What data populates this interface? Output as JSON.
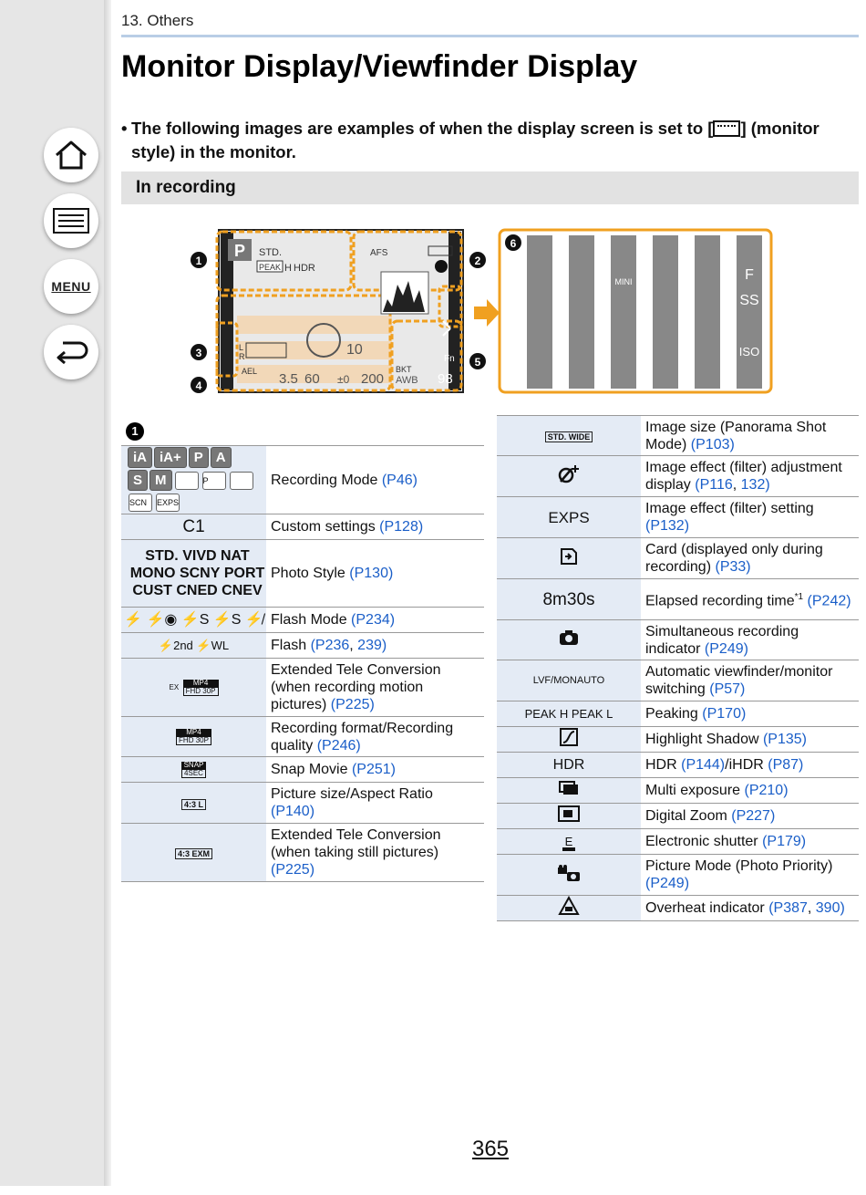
{
  "header": {
    "chapter": "13. Others",
    "title": "Monitor Display/Viewfinder Display"
  },
  "nav": {
    "menu_label": "MENU"
  },
  "intro": {
    "bullet": "•",
    "text_before": "The following images are examples of when the display screen is set to [",
    "text_after": "] (monitor style) in the monitor."
  },
  "section": {
    "title": "In recording"
  },
  "diagram": {
    "markers": [
      "1",
      "2",
      "3",
      "4",
      "5",
      "6"
    ],
    "screen": {
      "mode": "P",
      "style": "STD.",
      "peak": "PEAK",
      "peak_h": "H",
      "hdr": "HDR",
      "afs": "AFS",
      "ael": "AEL",
      "aperture": "3.5",
      "shutter": "60",
      "ev": "±0",
      "iso": "200",
      "awb": "AWB",
      "bkt": "BKT",
      "shots": "98",
      "count": "10",
      "fn": "Fn",
      "l": "L",
      "r": "R"
    },
    "tabs": [
      "MINI",
      "F",
      "SS",
      "ISO"
    ]
  },
  "left_table": {
    "heading_marker": "1",
    "mode_icons": [
      "iA",
      "iA+",
      "P",
      "A",
      "S",
      "M",
      "",
      "P",
      "",
      "SCN",
      "EXPS"
    ],
    "photo_styles": [
      "STD.",
      "VIVD",
      "NAT",
      "MONO",
      "SCNY",
      "PORT",
      "CUST",
      "CNED",
      "CNEV"
    ],
    "rows": [
      {
        "icon": "",
        "text": "Recording Mode ",
        "link": "(P46)"
      },
      {
        "icon": "C1",
        "text": "Custom settings ",
        "link": "(P128)"
      },
      {
        "icon": "",
        "text": "Photo Style ",
        "link": "(P130)"
      },
      {
        "icon": "⚡ ⚡◉ ⚡S ⚡S ⚡̸",
        "text": "Flash Mode ",
        "link": "(P234)"
      },
      {
        "icon": "⚡2nd ⚡WL",
        "text": "Flash ",
        "link": "(P236",
        "link2": "239)"
      },
      {
        "icon": "",
        "text": "Extended Tele Conversion (when recording motion pictures) ",
        "link": "(P225)"
      },
      {
        "icon": "",
        "text": "Recording format/Recording quality ",
        "link": "(P246)"
      },
      {
        "icon": "",
        "text": "Snap Movie ",
        "link": "(P251)"
      },
      {
        "icon": "4:3 L",
        "text": "Picture size/Aspect Ratio ",
        "link": "(P140)"
      },
      {
        "icon": "4:3 EXM",
        "text": "Extended Tele Conversion (when taking still pictures) ",
        "link": "(P225)"
      }
    ],
    "mp4_top": "MP4",
    "mp4_bot": "FHD 30P",
    "ex": "EX",
    "snap_top": "SNAP",
    "snap_bot": "4SEC"
  },
  "right_table": {
    "rows": [
      {
        "icon": "STD.  WIDE",
        "text": "Image size (Panorama Shot Mode) ",
        "link": "(P103)"
      },
      {
        "icon": "",
        "text": "Image effect (filter) adjustment display ",
        "link": "(P116",
        "link2": "132)"
      },
      {
        "icon": "EXPS",
        "text": "Image effect (filter) setting ",
        "link": "(P132)"
      },
      {
        "icon": "",
        "text": "Card (displayed only during recording) ",
        "link": "(P33)"
      },
      {
        "icon": "8m30s",
        "text": "Elapsed recording time",
        "sup": "*1",
        "link": "(P242)"
      },
      {
        "icon": "",
        "text": "Simultaneous recording indicator ",
        "link": "(P249)"
      },
      {
        "icon": "LVF/MONAUTO",
        "text": "Automatic viewfinder/monitor switching ",
        "link": "(P57)"
      },
      {
        "icon": "PEAK H PEAK L",
        "text": "Peaking ",
        "link": "(P170)"
      },
      {
        "icon": "",
        "text": "Highlight Shadow ",
        "link": "(P135)"
      },
      {
        "icon": "HDR",
        "text": "HDR ",
        "link": "(P144)",
        "text2": "/iHDR ",
        "link2": "(P87)"
      },
      {
        "icon": "",
        "text": "Multi exposure ",
        "link": "(P210)"
      },
      {
        "icon": "",
        "text": "Digital Zoom ",
        "link": "(P227)"
      },
      {
        "icon": "E",
        "text": "Electronic shutter ",
        "link": "(P179)"
      },
      {
        "icon": "",
        "text": "Picture Mode (Photo Priority) ",
        "link": "(P249)"
      },
      {
        "icon": "",
        "text": "Overheat indicator ",
        "link": "(P387",
        "link2": "390)"
      }
    ]
  },
  "footer": {
    "page_number": "365"
  },
  "colors": {
    "accent_orange": "#f0a020",
    "link": "#1a5ec8",
    "icon_cell": "#e4ebf5",
    "sidebar": "#e6e6e6"
  }
}
